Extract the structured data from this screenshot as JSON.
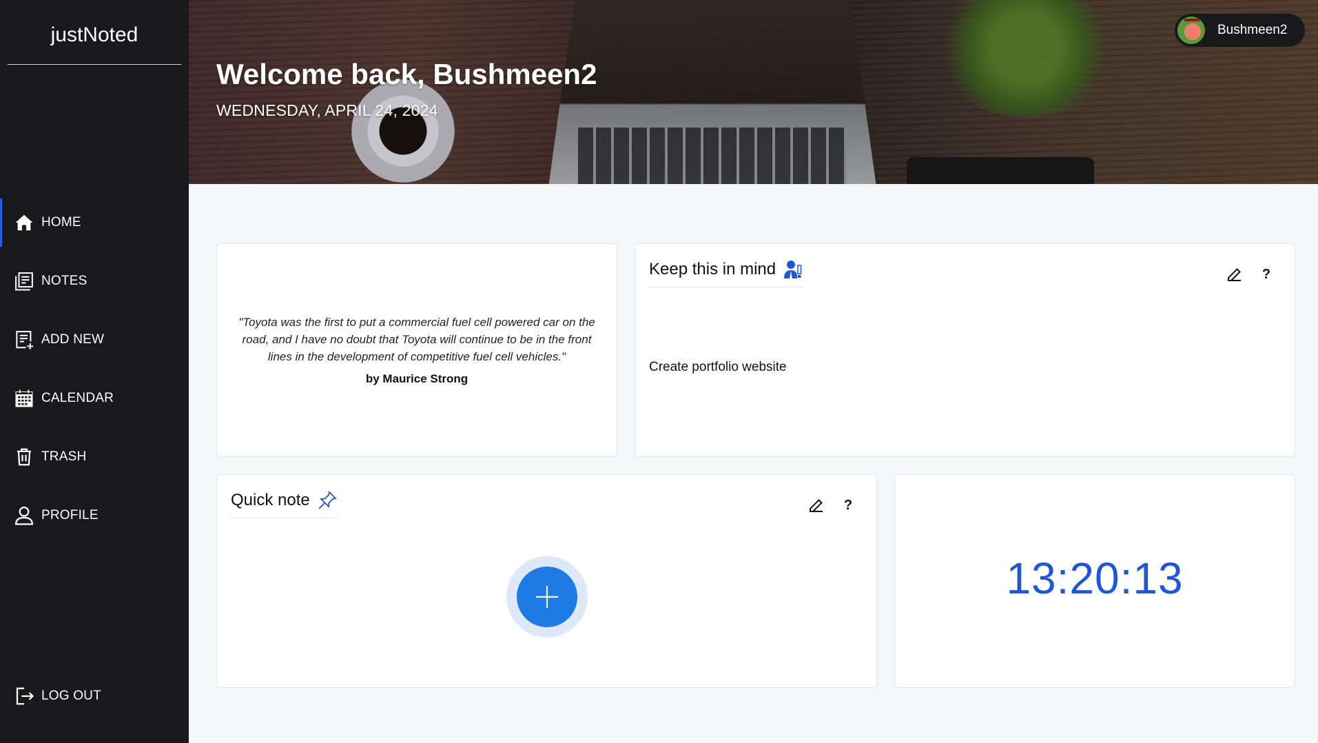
{
  "app": {
    "brand": "justNoted"
  },
  "sidebar": {
    "items": [
      {
        "label": "HOME",
        "icon": "home-icon",
        "active": true
      },
      {
        "label": "NOTES",
        "icon": "notes-icon"
      },
      {
        "label": "ADD NEW",
        "icon": "add-note-icon"
      },
      {
        "label": "CALENDAR",
        "icon": "calendar-icon"
      },
      {
        "label": "TRASH",
        "icon": "trash-icon"
      },
      {
        "label": "PROFILE",
        "icon": "user-icon"
      }
    ],
    "logout": {
      "label": "LOG OUT",
      "icon": "logout-icon"
    }
  },
  "header": {
    "welcome": "Welcome back, Bushmeen2",
    "date": "WEDNESDAY, APRIL 24, 2024",
    "user": {
      "name": "Bushmeen2",
      "avatar": "avatar-image"
    }
  },
  "quote": {
    "text": "\"Toyota was the first to put a commercial fuel cell powered car on the road, and I have no doubt that Toyota will continue to be in the front lines in the development of competitive fuel cell vehicles.\"",
    "author": "by Maurice Strong"
  },
  "keep_in_mind": {
    "title": "Keep this in mind",
    "icon": "user-alert-icon",
    "text": "Create portfolio website",
    "edit_icon": "pencil-icon",
    "help_label": "?"
  },
  "quick_note": {
    "title": "Quick note",
    "icon": "pin-icon",
    "edit_icon": "pencil-icon",
    "help_label": "?",
    "add_icon": "plus-icon"
  },
  "clock": {
    "time": "13:20:13"
  },
  "colors": {
    "accent": "#1f55d6",
    "add_button": "#1e7be5",
    "sidebar_bg": "#19191b",
    "page_bg": "#f5f6fa"
  }
}
